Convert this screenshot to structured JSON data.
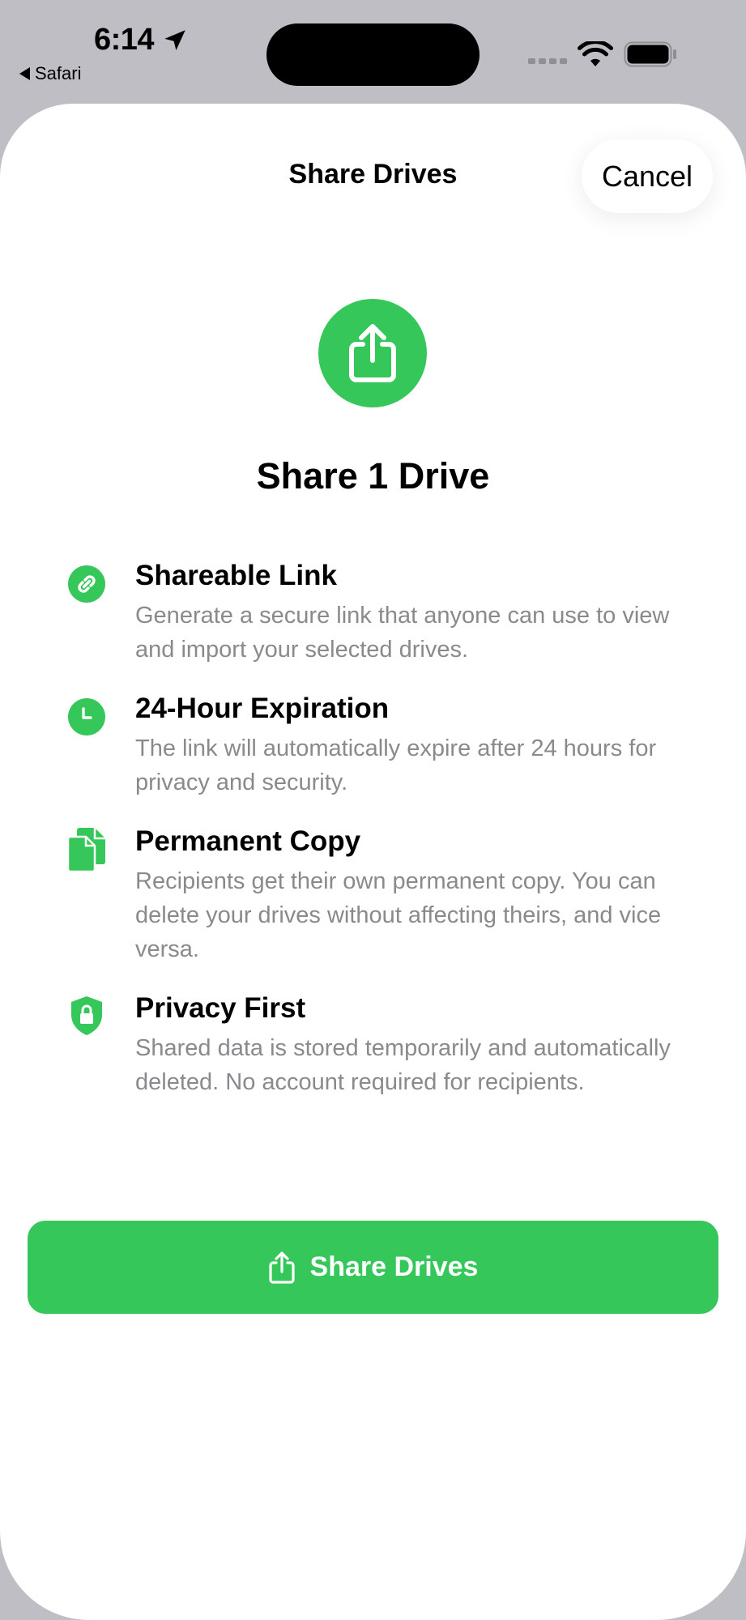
{
  "status_bar": {
    "time": "6:14",
    "back_app": "Safari"
  },
  "sheet": {
    "nav_title": "Share Drives",
    "cancel_label": "Cancel",
    "hero_title": "Share 1 Drive",
    "features": [
      {
        "icon": "link-icon",
        "title": "Shareable Link",
        "description": "Generate a secure link that anyone can use to view and import your selected drives."
      },
      {
        "icon": "clock-icon",
        "title": "24-Hour Expiration",
        "description": "The link will automatically expire after 24 hours for privacy and security."
      },
      {
        "icon": "documents-icon",
        "title": "Permanent Copy",
        "description": "Recipients get their own permanent copy. You can delete your drives without affecting theirs, and vice versa."
      },
      {
        "icon": "lock-shield-icon",
        "title": "Privacy First",
        "description": "Shared data is stored temporarily and automatically deleted. No account required for recipients."
      }
    ],
    "share_button_label": "Share Drives"
  },
  "colors": {
    "accent": "#35c759",
    "secondary_text": "#8a8a8e",
    "backdrop": "#bebec4"
  }
}
